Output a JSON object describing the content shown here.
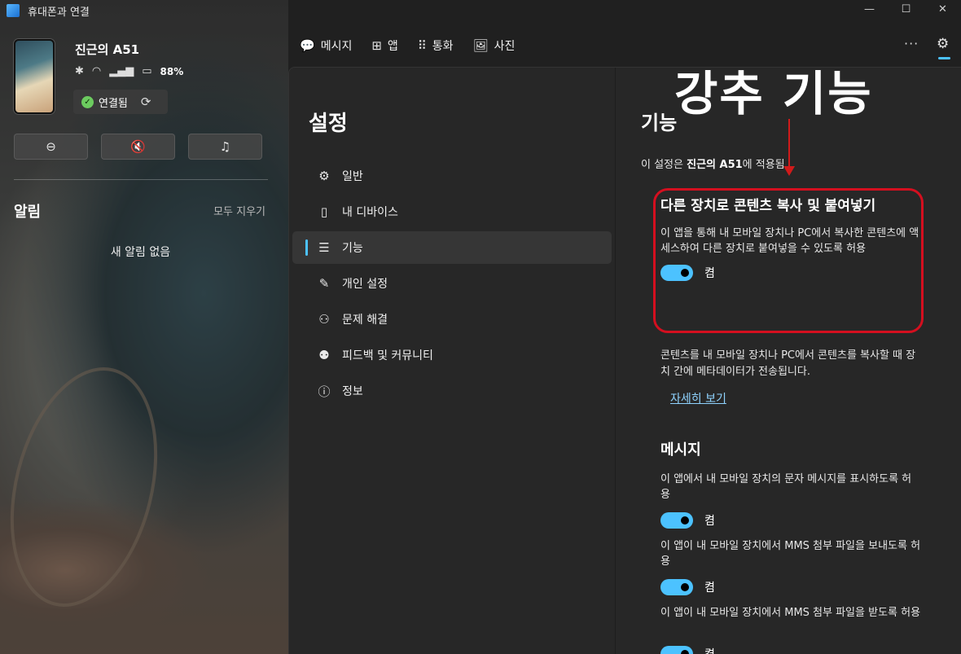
{
  "window": {
    "title": "휴대폰과 연결",
    "controls": [
      "—",
      "☐",
      "✕"
    ]
  },
  "device": {
    "name": "진근의 A51",
    "battery": "88%",
    "connection_status": "연결됨",
    "quick_actions": [
      "⊖",
      "🔇",
      "♫"
    ]
  },
  "alerts": {
    "title": "알림",
    "clear_all": "모두 지우기",
    "empty": "새 알림 없음"
  },
  "topnav": {
    "items": [
      {
        "icon": "💬",
        "label": "메시지"
      },
      {
        "icon": "⊞",
        "label": "앱"
      },
      {
        "icon": "⠿",
        "label": "통화"
      },
      {
        "icon": "🖼",
        "label": "사진"
      }
    ],
    "more": "···",
    "settings_icon": "⚙"
  },
  "settings": {
    "title": "설정",
    "nav": [
      {
        "icon": "⚙",
        "label": "일반"
      },
      {
        "icon": "▯",
        "label": "내 디바이스"
      },
      {
        "icon": "☰",
        "label": "기능"
      },
      {
        "icon": "✎",
        "label": "개인 설정"
      },
      {
        "icon": "⚇",
        "label": "문제 해결"
      },
      {
        "icon": "⚉",
        "label": "피드백 및 커뮤니티"
      },
      {
        "icon": "ⓘ",
        "label": "정보"
      }
    ]
  },
  "features": {
    "title": "기능",
    "applies_prefix": "이 설정은 ",
    "applies_device": "진근의 A51",
    "applies_suffix": "에 적용됨",
    "copy_paste": {
      "title": "다른 장치로 콘텐츠 복사 및 붙여넣기",
      "description": "이 앱을 통해 내 모바일 장치나 PC에서 복사한 콘텐츠에 액세스하여 다른 장치로 붙여넣을 수 있도록 허용",
      "toggle_label": "켬"
    },
    "metadata_note": "콘텐츠를 내 모바일 장치나 PC에서 콘텐츠를 복사할 때 장치 간에 메타데이터가 전송됩니다.",
    "more_link": "자세히 보기",
    "messages": {
      "title": "메시지",
      "items": [
        {
          "text": "이 앱에서 내 모바일 장치의 문자 메시지를 표시하도록 허용",
          "toggle_label": "켬"
        },
        {
          "text": "이 앱이 내 모바일 장치에서 MMS 첨부 파일을 보내도록 허용",
          "toggle_label": "켬"
        },
        {
          "text": "이 앱이 내 모바일 장치에서 MMS 첨부 파일을 받도록 허용",
          "toggle_label": "켬"
        }
      ]
    }
  },
  "annotation": {
    "label": "강추 기능",
    "color": "#d40f1f"
  },
  "colors": {
    "accent": "#4cc2ff",
    "panel": "#272727",
    "success": "#6ccb5f"
  }
}
